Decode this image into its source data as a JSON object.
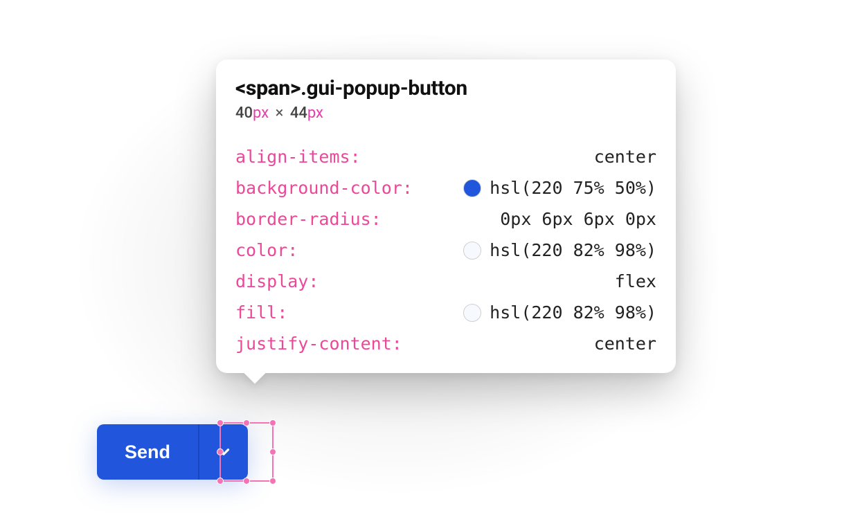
{
  "tooltip": {
    "selector_tag": "<span>",
    "selector_class": ".gui-popup-button",
    "dims": {
      "w": "40",
      "w_unit": "px",
      "times": "×",
      "h": "44",
      "h_unit": "px"
    },
    "props": [
      {
        "name": "align-items",
        "value": "center",
        "swatch": null
      },
      {
        "name": "background-color",
        "value": "hsl(220 75% 50%)",
        "swatch": "#2055dc"
      },
      {
        "name": "border-radius",
        "value": "0px 6px 6px 0px",
        "swatch": null
      },
      {
        "name": "color",
        "value": "hsl(220 82% 98%)",
        "swatch": "#f6f9fe"
      },
      {
        "name": "display",
        "value": "flex",
        "swatch": null
      },
      {
        "name": "fill",
        "value": "hsl(220 82% 98%)",
        "swatch": "#f6f9fe"
      },
      {
        "name": "justify-content",
        "value": "center",
        "swatch": null
      }
    ]
  },
  "button": {
    "main_label": "Send",
    "popup_icon": "chevron-down"
  },
  "colors": {
    "accent": "#2055dc",
    "pink": "#ec4899",
    "select": "#f472b6"
  }
}
